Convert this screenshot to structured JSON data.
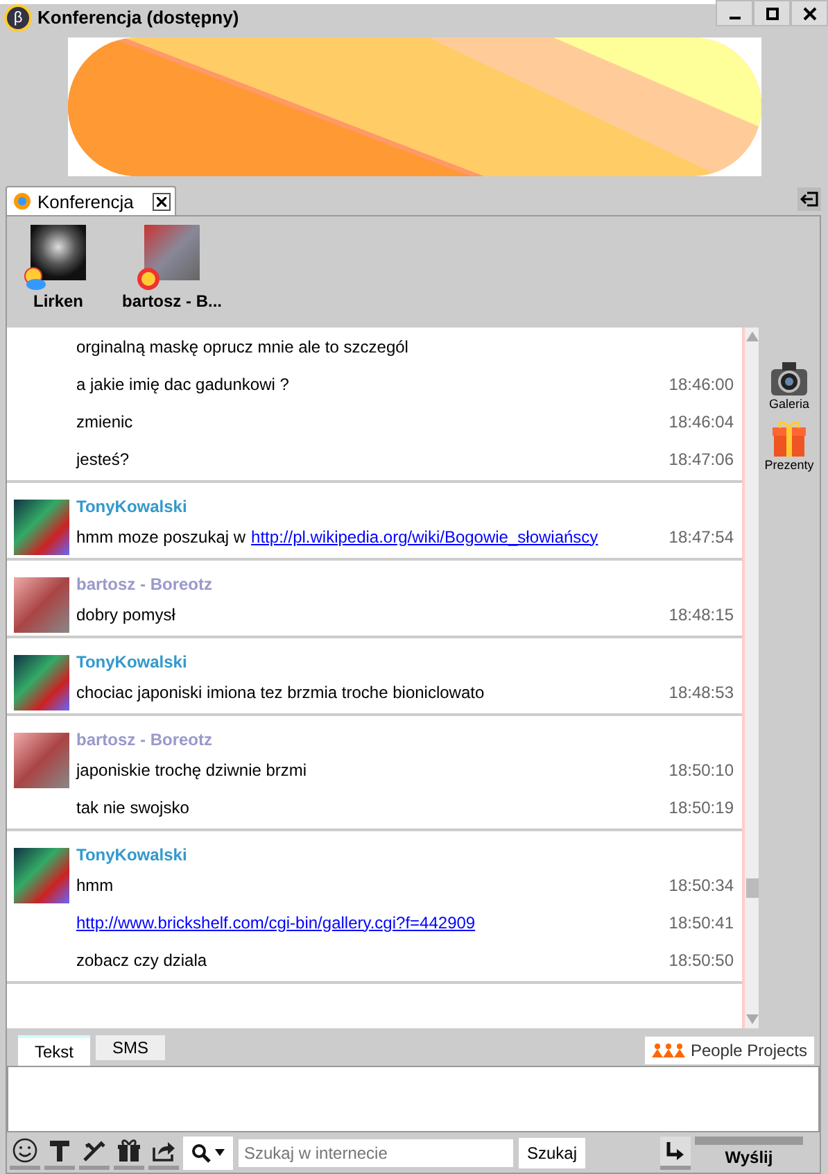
{
  "window": {
    "title": "Konferencja (dostępny)",
    "badge": "β"
  },
  "tabs": [
    {
      "label": "Konferencja",
      "selected": true
    }
  ],
  "participants": [
    {
      "name": "Lirken",
      "kind": "cloudy"
    },
    {
      "name": "bartosz - B...",
      "kind": "sunny"
    }
  ],
  "messages": [
    {
      "lines": [
        {
          "parts": [
            {
              "kind": "text",
              "text": "orginalną maskę oprucz mnie ale to szczegól"
            }
          ]
        },
        {
          "parts": [
            {
              "kind": "text",
              "text": "a jakie imię dac gadunkowi ?"
            }
          ],
          "time": "18:46:00"
        },
        {
          "parts": [
            {
              "kind": "text",
              "text": "zmienic"
            }
          ],
          "time": "18:46:04"
        },
        {
          "parts": [
            {
              "kind": "text",
              "text": "jesteś?"
            }
          ],
          "time": "18:47:06"
        }
      ]
    },
    {
      "sender": "TonyKowalski",
      "color": "#3399cc",
      "lines": [
        {
          "parts": [
            {
              "kind": "text",
              "text": "hmm moze poszukaj w"
            },
            {
              "kind": "link",
              "text": "http://pl.wikipedia.org/wiki/Bogowie_słowiańscy"
            }
          ],
          "time": "18:47:54"
        }
      ]
    },
    {
      "sender": "bartosz - Boreotz",
      "color": "#9999cc",
      "lines": [
        {
          "parts": [
            {
              "kind": "text",
              "text": "dobry pomysł"
            }
          ],
          "time": "18:48:15"
        }
      ]
    },
    {
      "sender": "TonyKowalski",
      "color": "#3399cc",
      "lines": [
        {
          "parts": [
            {
              "kind": "text",
              "text": "chociac japoniski imiona tez brzmia troche bioniclowato"
            }
          ],
          "time": "18:48:53"
        }
      ]
    },
    {
      "sender": "bartosz - Boreotz",
      "color": "#9999cc",
      "lines": [
        {
          "parts": [
            {
              "kind": "text",
              "text": "japoniskie trochę dziwnie brzmi"
            }
          ],
          "time": "18:50:10"
        },
        {
          "parts": [
            {
              "kind": "text",
              "text": "tak nie swojsko"
            }
          ],
          "time": "18:50:19"
        }
      ]
    },
    {
      "sender": "TonyKowalski",
      "color": "#3399cc",
      "lines": [
        {
          "parts": [
            {
              "kind": "text",
              "text": "hmm"
            }
          ],
          "time": "18:50:34"
        },
        {
          "parts": [
            {
              "kind": "link",
              "text": "http://www.brickshelf.com/cgi-bin/gallery.cgi?f=442909"
            }
          ],
          "time": "18:50:41"
        },
        {
          "parts": [
            {
              "kind": "text",
              "text": "zobacz czy dziala"
            }
          ],
          "time": "18:50:50"
        }
      ]
    }
  ],
  "side_tools": [
    {
      "label": "Galeria",
      "kind": "camera"
    },
    {
      "label": "Prezenty",
      "kind": "gift"
    }
  ],
  "input_tabs": [
    {
      "label": "Tekst",
      "selected": true
    },
    {
      "label": "SMS",
      "selected": false
    }
  ],
  "brand": "People Projects",
  "search": {
    "placeholder": "Szukaj w internecie",
    "button": "Szukaj"
  },
  "send_button": "Wyślij"
}
